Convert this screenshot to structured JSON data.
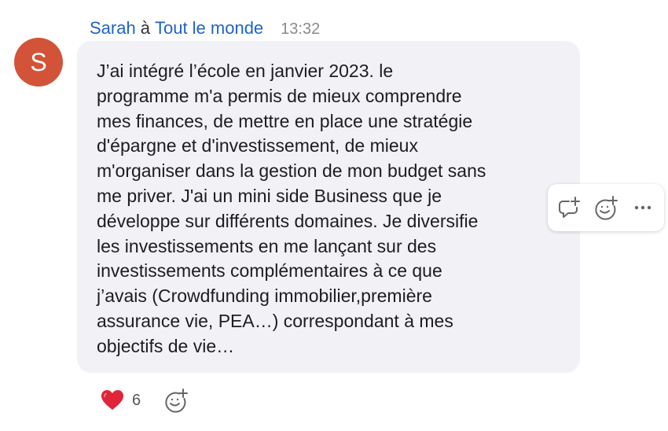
{
  "sender": {
    "name": "Sarah",
    "avatar_initial": "S",
    "avatar_color": "#d35338"
  },
  "header": {
    "preposition": "à",
    "recipient": "Tout le monde",
    "time": "13:32"
  },
  "message": {
    "lines": [
      "J’ai intégré l’école en janvier 2023. le",
      "programme m'a permis de mieux comprendre",
      "mes finances, de mettre en place une stratégie",
      "d'épargne et d'investissement, de mieux",
      "m'organiser dans la gestion de mon budget sans",
      "me priver. J'ai un mini side Business que je",
      "développe sur différents domaines. Je  diversifie",
      "les investissements en me lançant sur des",
      "investissements complémentaires à ce que",
      "j’avais (Crowdfunding immobilier,première",
      "assurance vie, PEA…) correspondant à mes",
      "objectifs de vie…"
    ]
  },
  "hover_actions": {
    "icons": [
      "reply-thread-icon",
      "add-reaction-icon",
      "more-options-icon"
    ]
  },
  "reactions": {
    "items": [
      {
        "emoji": "❤️",
        "icon": "heart-icon",
        "count": "6"
      }
    ],
    "add_icon": "add-reaction-icon"
  },
  "colors": {
    "link": "#1f64c8",
    "bubble_bg": "#f2f2f6",
    "heart": "#e0243a"
  }
}
